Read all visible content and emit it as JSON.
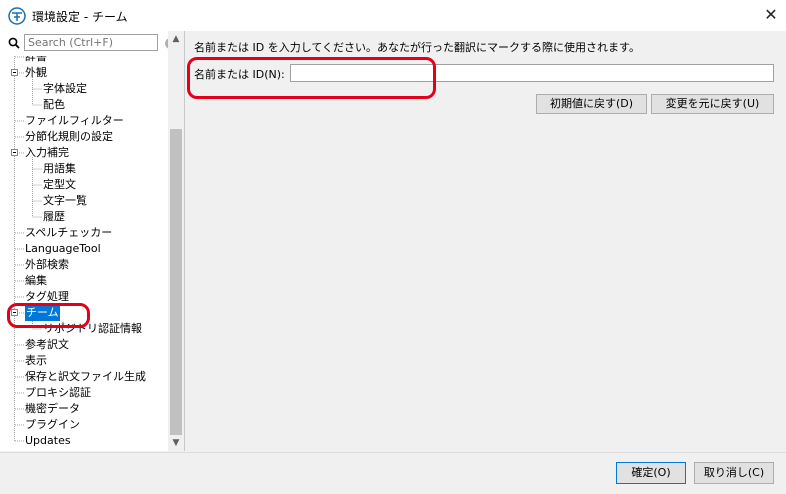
{
  "window": {
    "title": "環境設定 - チーム",
    "close_glyph": "✕",
    "icon": "app-icon"
  },
  "search": {
    "placeholder": "Search (Ctrl+F)",
    "clear_glyph": "✕"
  },
  "tree": {
    "items": [
      {
        "label": "辞書",
        "level": 0
      },
      {
        "label": "外観",
        "level": 0,
        "expander": true
      },
      {
        "label": "字体設定",
        "level": 1
      },
      {
        "label": "配色",
        "level": 1
      },
      {
        "label": "ファイルフィルター",
        "level": 0
      },
      {
        "label": "分節化規則の設定",
        "level": 0
      },
      {
        "label": "入力補完",
        "level": 0,
        "expander": true
      },
      {
        "label": "用語集",
        "level": 1
      },
      {
        "label": "定型文",
        "level": 1
      },
      {
        "label": "文字一覧",
        "level": 1
      },
      {
        "label": "履歴",
        "level": 1
      },
      {
        "label": "スペルチェッカー",
        "level": 0
      },
      {
        "label": "LanguageTool",
        "level": 0
      },
      {
        "label": "外部検索",
        "level": 0
      },
      {
        "label": "編集",
        "level": 0
      },
      {
        "label": "タグ処理",
        "level": 0
      },
      {
        "label": "チーム",
        "level": 0,
        "expander": true,
        "selected": true
      },
      {
        "label": "リポジトリ認証情報",
        "level": 1
      },
      {
        "label": "参考訳文",
        "level": 0
      },
      {
        "label": "表示",
        "level": 0
      },
      {
        "label": "保存と訳文ファイル生成",
        "level": 0
      },
      {
        "label": "プロキシ認証",
        "level": 0
      },
      {
        "label": "機密データ",
        "level": 0
      },
      {
        "label": "プラグイン",
        "level": 0
      },
      {
        "label": "Updates",
        "level": 0
      }
    ]
  },
  "scrollbar": {
    "up_glyph": "▲",
    "down_glyph": "▼"
  },
  "main": {
    "hint": "名前または ID を入力してください。あなたが行った翻訳にマークする際に使用されます。",
    "field_label": "名前または ID(N):",
    "field_value": "",
    "reset_button": "初期値に戻す(D)",
    "revert_button": "変更を元に戻す(U)"
  },
  "footer": {
    "ok_button": "確定(O)",
    "cancel_button": "取り消し(C)"
  },
  "colors": {
    "selection": "#0078d7",
    "annotation": "#e3001b"
  }
}
